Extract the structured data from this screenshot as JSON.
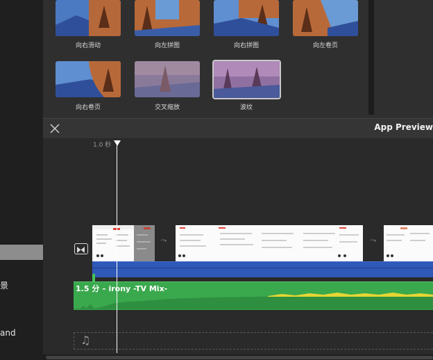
{
  "sidebar": {
    "items": [
      {
        "label": "景"
      },
      {
        "label": "and"
      }
    ]
  },
  "browser": {
    "transitions_row1": [
      "向右滑动",
      "向左拼图",
      "向右拼图",
      "向左卷页"
    ],
    "transitions_row2": [
      "向右卷页",
      "交叉缩放",
      "波纹"
    ],
    "selected": "波纹"
  },
  "header": {
    "title": "App Preview"
  },
  "timeline": {
    "playhead_time": "1.0 秒",
    "audio_clip_title": "1.5 分 – irony -TV Mix-",
    "transition_glyph": "⤳"
  },
  "colors": {
    "video_track": "#2f59b8",
    "audio_track": "#3aa84d",
    "waveform": "#e5d634",
    "selection": "#8d8d8d"
  },
  "icons": {
    "close": "close-icon",
    "transition": "transition-icon",
    "music": "music-note-icon"
  }
}
